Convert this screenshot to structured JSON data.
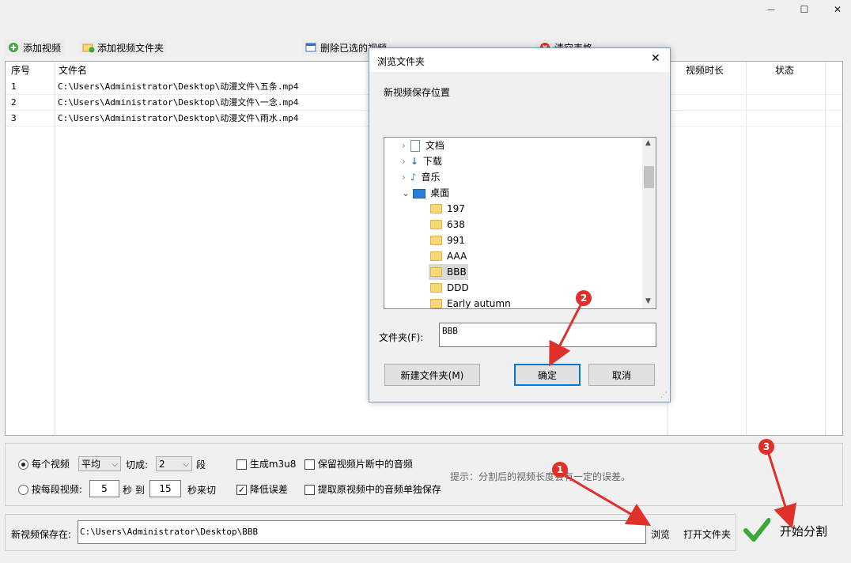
{
  "window": {
    "minimize": "—",
    "maximize": "☐",
    "close": "✕"
  },
  "toolbar": {
    "add_video": "添加视频",
    "add_folder": "添加视频文件夹",
    "delete_selected": "删除已选的视频",
    "clear_table": "清空表格"
  },
  "table": {
    "headers": {
      "index": "序号",
      "filename": "文件名",
      "duration": "视频时长",
      "status": "状态"
    },
    "rows": [
      {
        "index": "1",
        "filename": "C:\\Users\\Administrator\\Desktop\\动漫文件\\五条.mp4"
      },
      {
        "index": "2",
        "filename": "C:\\Users\\Administrator\\Desktop\\动漫文件\\一念.mp4"
      },
      {
        "index": "3",
        "filename": "C:\\Users\\Administrator\\Desktop\\动漫文件\\雨水.mp4"
      }
    ]
  },
  "options": {
    "each_video": "每个视频",
    "mode_value": "平均",
    "cut_label": "切成:",
    "cut_value": "2",
    "segment_unit": "段",
    "gen_m3u8": "生成m3u8",
    "keep_audio": "保留视频片断中的音频",
    "per_segment": "按每段视频:",
    "from_value": "5",
    "sec_to": "秒 到",
    "to_value": "15",
    "sec_cut": "秒来切",
    "reduce_error": "降低误差",
    "extract_audio": "提取原视频中的音频单独保存",
    "hint": "提示：分割后的视频长度会有一定的误差。"
  },
  "save": {
    "label": "新视频保存在:",
    "path": "C:\\Users\\Administrator\\Desktop\\BBB",
    "browse": "浏览",
    "open_folder": "打开文件夹",
    "start": "开始分割"
  },
  "dialog": {
    "title": "浏览文件夹",
    "prompt": "新视频保存位置",
    "tree": [
      {
        "label": "文档",
        "icon": "document-icon"
      },
      {
        "label": "下载",
        "icon": "download-arrow-icon"
      },
      {
        "label": "音乐",
        "icon": "music-note-icon"
      },
      {
        "label": "桌面",
        "icon": "desktop-icon"
      },
      {
        "label": "197"
      },
      {
        "label": "638"
      },
      {
        "label": "991"
      },
      {
        "label": "AAA"
      },
      {
        "label": "BBB"
      },
      {
        "label": "DDD"
      },
      {
        "label": "Early autumn"
      }
    ],
    "folder_label": "文件夹(F):",
    "folder_value": "BBB",
    "new_folder": "新建文件夹(M)",
    "ok": "确定",
    "cancel": "取消"
  },
  "badges": {
    "one": "1",
    "two": "2",
    "three": "3"
  },
  "colors": {
    "accent_red": "#e0302a",
    "selected": "#cce8ff",
    "check_green": "#3aa83a"
  }
}
